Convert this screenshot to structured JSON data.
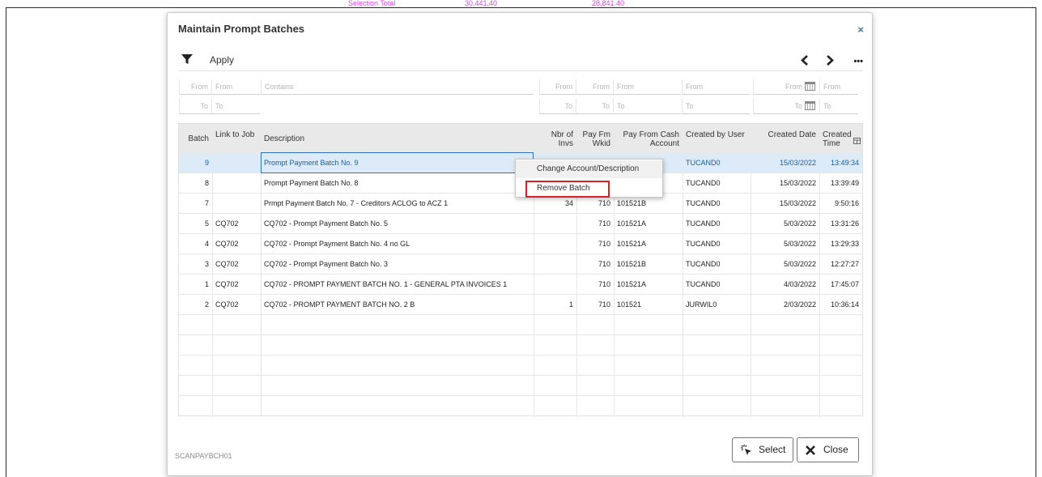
{
  "background": {
    "selection_total_label": "Selection Total",
    "value_1": "30,441.40",
    "value_2": "28,841.40"
  },
  "dialog": {
    "title": "Maintain Prompt Batches",
    "close_glyph": "×",
    "footer_code": "SCANPAYBCH01"
  },
  "toolbar": {
    "filter_icon": "filter-icon",
    "apply_label": "Apply",
    "prev_glyph": "‹",
    "next_glyph": "›",
    "more_glyph": "•••"
  },
  "filters": {
    "from": "From",
    "to": "To",
    "contains": "Contains"
  },
  "columns": [
    "Batch",
    "Link to Job",
    "Description",
    "Nbr of Invs",
    "Pay Fm Wkid",
    "Pay From Cash Account",
    "Created by User",
    "Created Date",
    "Created Time"
  ],
  "rows": [
    {
      "batch": "9",
      "job": "",
      "desc": "Prompt Payment Batch No. 9",
      "invs": "",
      "wkid": "",
      "acct": "",
      "user": "TUCAND0",
      "date": "15/03/2022",
      "time": "13:49:34"
    },
    {
      "batch": "8",
      "job": "",
      "desc": "Prompt Payment Batch No. 8",
      "invs": "",
      "wkid": "",
      "acct": "",
      "user": "TUCAND0",
      "date": "15/03/2022",
      "time": "13:39:49"
    },
    {
      "batch": "7",
      "job": "",
      "desc": "Prmpt Payment Batch No. 7 - Creditors ACLOG to ACZ 1",
      "invs": "34",
      "wkid": "710",
      "acct": "101521B",
      "user": "TUCAND0",
      "date": "15/03/2022",
      "time": "9:50:16"
    },
    {
      "batch": "5",
      "job": "CQ702",
      "desc": "CQ702 - Prompt Payment Batch No. 5",
      "invs": "",
      "wkid": "710",
      "acct": "101521A",
      "user": "TUCAND0",
      "date": "5/03/2022",
      "time": "13:31:26"
    },
    {
      "batch": "4",
      "job": "CQ702",
      "desc": "CQ702 - Prompt Payment Batch No. 4 no GL",
      "invs": "",
      "wkid": "710",
      "acct": "101521A",
      "user": "TUCAND0",
      "date": "5/03/2022",
      "time": "13:29:33"
    },
    {
      "batch": "3",
      "job": "CQ702",
      "desc": "CQ702 - Prompt Payment Batch No. 3",
      "invs": "",
      "wkid": "710",
      "acct": "101521B",
      "user": "TUCAND0",
      "date": "5/03/2022",
      "time": "12:27:27"
    },
    {
      "batch": "1",
      "job": "CQ702",
      "desc": "CQ702 - PROMPT PAYMENT BATCH NO. 1 - GENERAL PTA INVOICES 1",
      "invs": "",
      "wkid": "710",
      "acct": "101521A",
      "user": "TUCAND0",
      "date": "4/03/2022",
      "time": "17:45:07"
    },
    {
      "batch": "2",
      "job": "CQ702",
      "desc": "CQ702 - PROMPT PAYMENT BATCH NO. 2 B",
      "invs": "1",
      "wkid": "710",
      "acct": "101521",
      "user": "JURWIL0",
      "date": "2/03/2022",
      "time": "10:36:14"
    }
  ],
  "context_menu": {
    "item_1": "Change Account/Description",
    "item_2": "Remove Batch",
    "highlight_color": "#e02020"
  },
  "buttons": {
    "select_label": "Select",
    "close_label": "Close",
    "select_icon": "pointer-click-icon",
    "close_icon": "x-icon"
  }
}
